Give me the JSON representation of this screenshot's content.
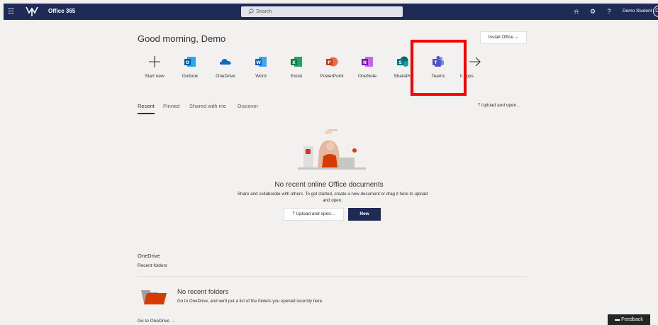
{
  "header": {
    "app_name": "Office 365",
    "search_placeholder": "Search",
    "user_name": "Demo Student",
    "avatar_initials": "DS",
    "brand_color": "#1d2b56"
  },
  "main": {
    "greeting": "Good morning, Demo",
    "install_label": "Install Office",
    "apps": [
      {
        "label": "Start new",
        "icon": "plus-icon"
      },
      {
        "label": "Outlook",
        "icon": "outlook-icon"
      },
      {
        "label": "OneDrive",
        "icon": "onedrive-icon"
      },
      {
        "label": "Word",
        "icon": "word-icon"
      },
      {
        "label": "Excel",
        "icon": "excel-icon"
      },
      {
        "label": "PowerPoint",
        "icon": "powerpoint-icon"
      },
      {
        "label": "OneNote",
        "icon": "onenote-icon"
      },
      {
        "label": "SharePo",
        "icon": "sharepoint-icon"
      },
      {
        "label": "Teams",
        "icon": "teams-icon"
      },
      {
        "label": "ll apps",
        "icon": "arrow-right-icon"
      }
    ],
    "highlight_color": "#ff0000",
    "tabs": [
      "Recent",
      "Pinned",
      "Shared with me",
      "Discover"
    ],
    "upload_label": "Upload and open...",
    "empty_title": "No recent online Office documents",
    "empty_desc": "Share and collaborate with others. To get started, create a new document or drag it here to upload and open.",
    "upload_button": "Upload and open...",
    "new_button": "New"
  },
  "onedrive": {
    "title": "OneDrive",
    "subtitle": "Recent folders",
    "empty_title": "No recent folders",
    "empty_desc": "Go to OneDrive, and we'll put a list of the folders you opened recently here.",
    "link": "Go to OneDrive"
  },
  "feedback_label": "Feedback"
}
